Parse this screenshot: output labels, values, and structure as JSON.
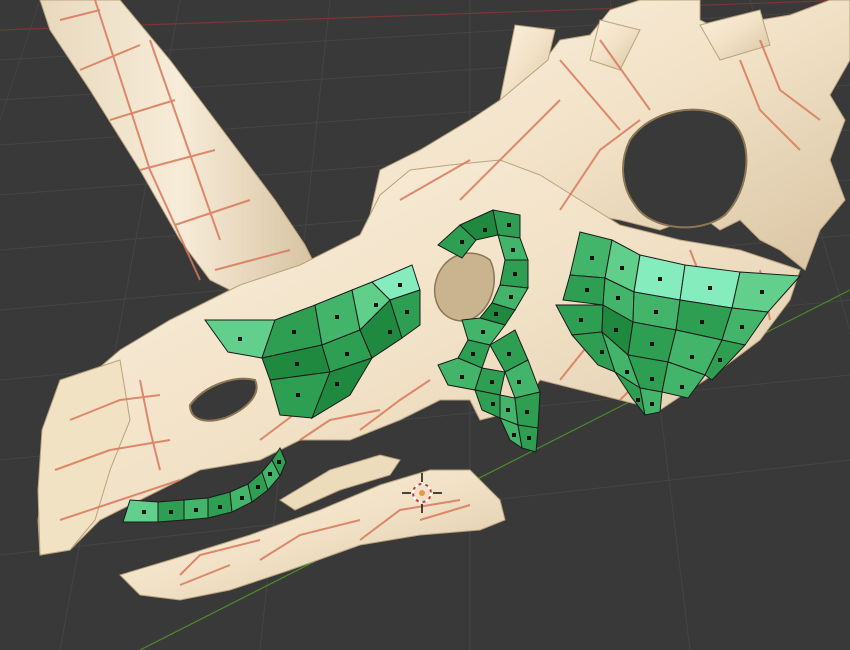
{
  "viewport": {
    "background_color": "#393939",
    "grid_color": "#454545",
    "axis_x_color": "#8a3a3a",
    "axis_y_color": "#4f8a2a"
  },
  "model": {
    "bone_color": "#f3e6cf",
    "seam_color": "#d9785a",
    "selected_face_colors": [
      "#1f8a3f",
      "#2e9f52",
      "#43b56a",
      "#5fcf8a",
      "#85edbd"
    ],
    "dot_color": "#101010",
    "edge_color": "#1a1a1a"
  },
  "cursor": {
    "icon": "3d-cursor-icon",
    "ring_colors": [
      "#c23b3b",
      "#ffffff"
    ],
    "center_color": "#e39a4a"
  }
}
